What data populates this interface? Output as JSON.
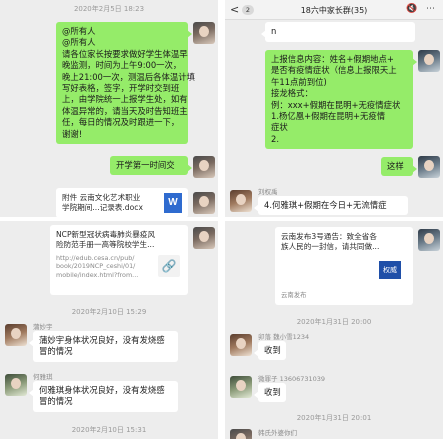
{
  "top_left": {
    "timestamp": "2020年2月5日 18:23",
    "notice_lines": [
      "@所有人",
      "@所有人",
      "请各位家长按要求做好学生体温早",
      "晚监测，时间为上午9:00一次，",
      "晚上21:00一次，测温后各体温计填",
      "写好表格，签字，开学时交到班",
      "上，由学院统一上报学生处，如有",
      "体温异常的，请当天及时告知班主",
      "任，每日的情况及时跟进一下，",
      "谢谢!"
    ],
    "school_bubble": "开学第一时间交",
    "file_card": {
      "title_lines": [
        "附件  云南文化艺术职业",
        "学院期间...记录表.docx"
      ],
      "icon": "W"
    }
  },
  "top_right": {
    "header": {
      "back": "<",
      "badge": "2",
      "title": "18六中家长群(35)",
      "icons": [
        "🔇",
        "⋯"
      ]
    },
    "top_text": "n",
    "info_lines": [
      "上报信息内容：姓名+假期地点+",
      "是否有疫情症状（信息上报限天上",
      "午11点前到位)",
      "接龙格式：",
      "例：xxx+假期在昆明+无疫情症状",
      "1.杨亿凰+假期在昆明+无疫情",
      "症状",
      "2."
    ],
    "reply_bubble": "这样",
    "sender1": "刘权禹",
    "msg1": "4.何雅琪+假期在今日+无流情症",
    "card": {
      "title_lines": [
        "云南发布3号通告：致全省各",
        "族人民的一封信，请共同做..."
      ],
      "source": "云南发布",
      "logo": "权威"
    }
  },
  "bottom_left": {
    "link_card": {
      "title_lines": [
        "NCP新型冠状病毒肺炎暴疫风",
        "险防范手册一高等院校学生..."
      ],
      "url_lines": [
        "http://edub.cesa.cn/pub/",
        "book/2019NCP_ceshi/01/",
        "mobile/index.html?from..."
      ]
    },
    "timestamp1": "2020年2月10日 15:29",
    "sender1": "蒲妙宇",
    "msg1_lines": [
      "蒲妙宇身体状况良好，没有发烧感",
      "冒的情况"
    ],
    "sender2": "何雅琪",
    "msg2_lines": [
      "何雅琪身体状况良好，没有发烧感",
      "冒的情况"
    ],
    "timestamp2": "2020年2月10日 15:31"
  },
  "bottom_right": {
    "timestamp1": "2020年1月31日 20:00",
    "sender1": "卯落 魏小雪1234",
    "msg1": "收到",
    "sender2": "微罪子 13606731039",
    "msg2": "收到",
    "timestamp2": "2020年1月31日 20:01",
    "sender3": "韩氏外婆你们"
  },
  "colors": {
    "green_bubble": "#95ec69",
    "chat_bg": "#ededed",
    "white_bubble": "#ffffff"
  }
}
